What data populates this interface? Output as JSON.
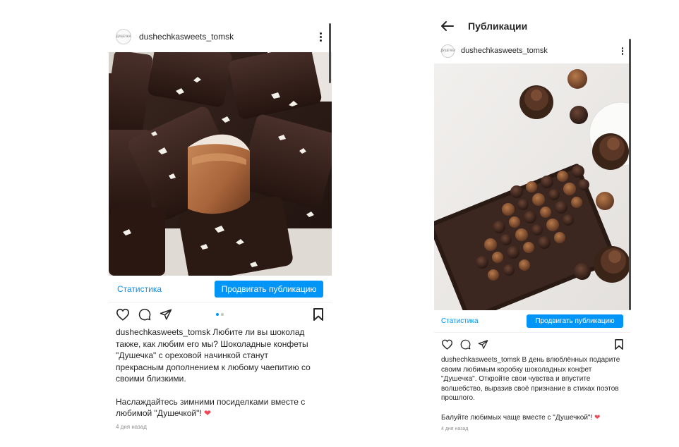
{
  "left_post": {
    "username": "dushechkasweets_tomsk",
    "avatar_text": "ДУШЕЧКА",
    "stats_label": "Статистика",
    "promote_label": "Продвигать публикацию",
    "caption_user": "dushechkasweets_tomsk",
    "caption_text": "Любите ли вы шоколад также, как любим его мы? Шоколадные конфеты \"Душечка\" с ореховой начинкой станут прекрасным дополнением к любому чаепитию со своими близкими.",
    "caption_text2": "Наслаждайтесь зимними посиделками вместе с любимой \"Душечкой\"!",
    "heart": "❤",
    "posted_ago": "4 дня назад"
  },
  "right_post": {
    "page_title": "Публикации",
    "username": "dushechkasweets_tomsk",
    "avatar_text": "ДУШЕЧКА",
    "stats_label": "Статистика",
    "promote_label": "Продвигать публикацию",
    "caption_user": "dushechkasweets_tomsk",
    "caption_text": "В день влюблённых подарите своим любимым коробку шоколадных конфет \"Душечка\". Откройте свои чувства и впустите волшебство, выразив своё признание в стихах поэтов прошлого.",
    "caption_text2": "Балуйте любимых чаще вместе с \"Душечкой\"!",
    "heart": "❤",
    "posted_ago": "4 дня назад"
  },
  "colors": {
    "accent": "#0095f6",
    "text": "#262626",
    "muted": "#8e8e8e",
    "heart": "#ed4956"
  },
  "icons": [
    "more-vertical-icon",
    "heart-icon",
    "comment-icon",
    "share-icon",
    "bookmark-icon",
    "back-arrow-icon"
  ]
}
